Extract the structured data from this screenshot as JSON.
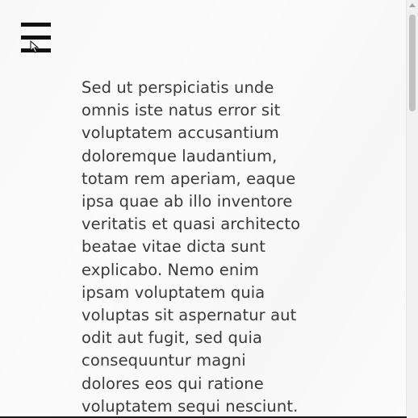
{
  "menu": {
    "icon": "hamburger-menu-icon"
  },
  "article": {
    "lines": [
      "Sed ut perspiciatis unde",
      "omnis iste natus error sit",
      "voluptatem accusantium",
      "doloremque laudantium,",
      "totam rem aperiam, eaque",
      "ipsa quae ab illo inventore",
      "veritatis et quasi architecto",
      "beatae vitae dicta sunt",
      "explicabo. Nemo enim",
      "ipsam voluptatem quia",
      "voluptas sit aspernatur aut",
      "odit aut fugit, sed quia",
      "consequuntur magni",
      "dolores eos qui ratione",
      "voluptatem sequi nesciunt."
    ]
  },
  "colors": {
    "text": "#3a3a3a",
    "menu_bars": "#111111",
    "background": "#fbfbfb"
  }
}
